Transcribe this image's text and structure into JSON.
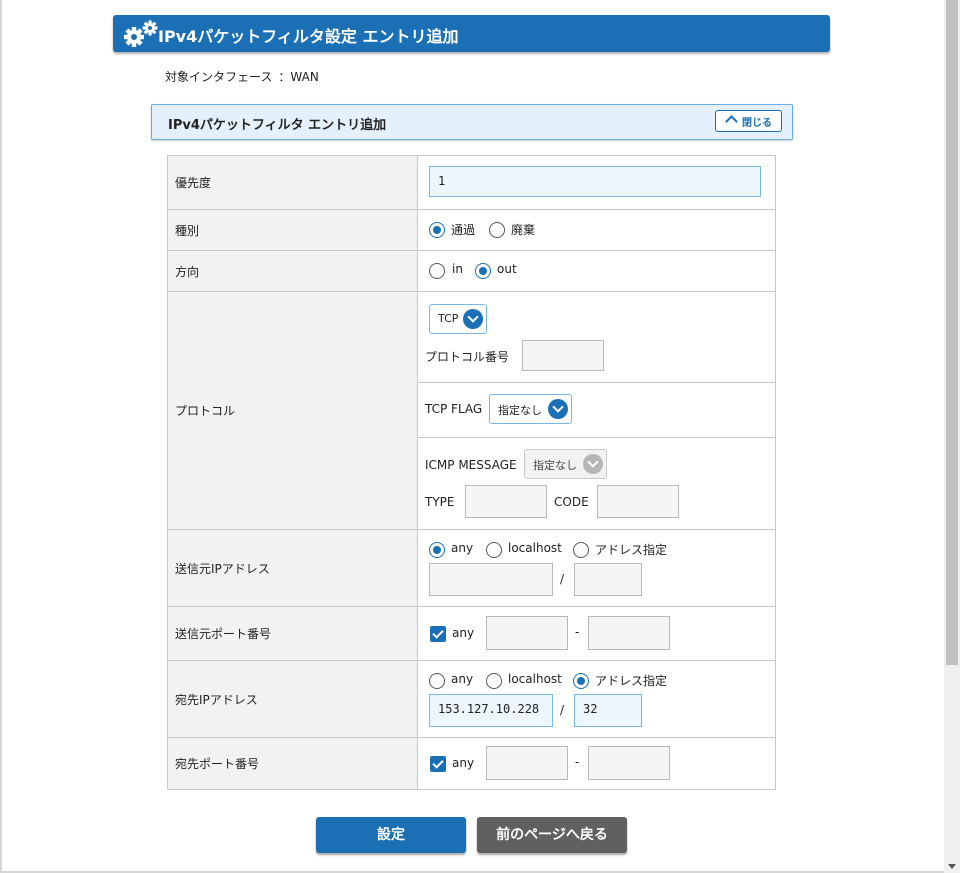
{
  "page": {
    "title": "IPv4パケットフィルタ設定 エントリ追加",
    "interface_label": "対象インタフェース",
    "interface_value": "：WAN"
  },
  "section": {
    "title": "IPv4パケットフィルタ エントリ追加",
    "close_label": "閉じる"
  },
  "form": {
    "priority": {
      "label": "優先度",
      "value": "1"
    },
    "type": {
      "label": "種別",
      "options": [
        "通過",
        "廃棄"
      ],
      "selected": "通過"
    },
    "direction": {
      "label": "方向",
      "options": [
        "in",
        "out"
      ],
      "selected": "out"
    },
    "protocol": {
      "label": "プロトコル",
      "select_value": "TCP",
      "number_label": "プロトコル番号",
      "number_value": "",
      "tcp_flag_label": "TCP FLAG",
      "tcp_flag_value": "指定なし",
      "icmp_label": "ICMP MESSAGE",
      "icmp_value": "指定なし",
      "type_label": "TYPE",
      "type_value": "",
      "code_label": "CODE",
      "code_value": ""
    },
    "src_ip": {
      "label": "送信元IPアドレス",
      "options": [
        "any",
        "localhost",
        "アドレス指定"
      ],
      "selected": "any",
      "address": "",
      "slash": "/",
      "prefix": ""
    },
    "src_port": {
      "label": "送信元ポート番号",
      "any_label": "any",
      "any_checked": true,
      "from": "",
      "dash": "-",
      "to": ""
    },
    "dst_ip": {
      "label": "宛先IPアドレス",
      "options": [
        "any",
        "localhost",
        "アドレス指定"
      ],
      "selected": "アドレス指定",
      "address": "153.127.10.228",
      "slash": "/",
      "prefix": "32"
    },
    "dst_port": {
      "label": "宛先ポート番号",
      "any_label": "any",
      "any_checked": true,
      "from": "",
      "dash": "-",
      "to": ""
    }
  },
  "buttons": {
    "submit": "設定",
    "back": "前のページへ戻る"
  },
  "colors": {
    "primary": "#1a6fb5",
    "header_bg": "#e4f0fb",
    "secondary_button": "#606060"
  }
}
